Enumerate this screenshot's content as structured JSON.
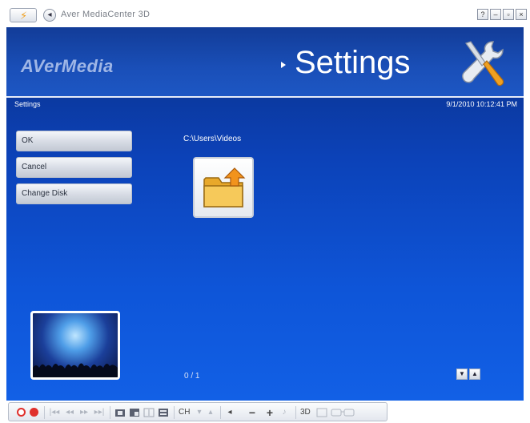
{
  "window": {
    "title": "Aver MediaCenter 3D",
    "controls": {
      "help": "?",
      "minimize": "–",
      "restore": "▫",
      "close": "×"
    }
  },
  "header": {
    "logo": "AVerMedia",
    "page_title": "Settings",
    "breadcrumb": "Settings",
    "datetime": "9/1/2010 10:12:41 PM"
  },
  "menu": {
    "items": [
      {
        "label": "OK"
      },
      {
        "label": "Cancel"
      },
      {
        "label": "Change Disk"
      }
    ]
  },
  "content": {
    "path": "C:\\Users\\Videos",
    "page_count": "0 / 1"
  },
  "controlbar": {
    "ch_label": "CH",
    "three_d_label": "3D",
    "glyphs": {
      "prev": "|◂◂",
      "rewind": "◂◂",
      "forward": "▸▸",
      "next": "▸▸|",
      "ch_down": "▾",
      "ch_up": "▴",
      "mute": "◂",
      "vol_down": "−",
      "vol_up": "+",
      "vol_extra": "♪",
      "scroll_down": "▼",
      "scroll_up": "▲"
    }
  },
  "colors": {
    "accent_blue": "#0e55d8",
    "record_red": "#e0302c",
    "folder_orange": "#f2931c"
  }
}
